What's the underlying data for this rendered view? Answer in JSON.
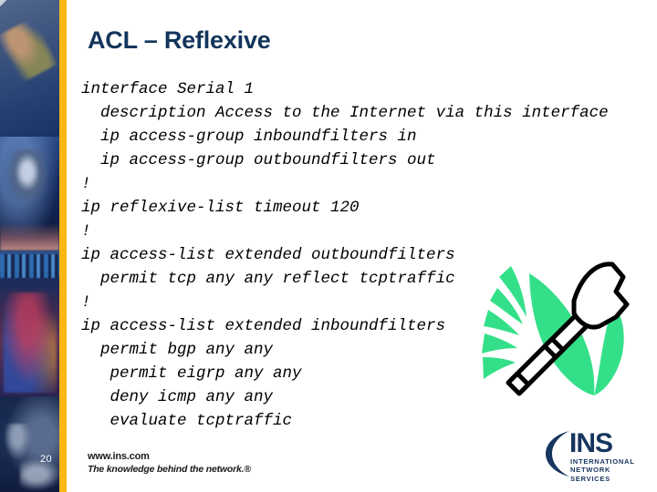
{
  "slide": {
    "title": "ACL – Reflexive",
    "number": "20",
    "background_color": "#ffffff",
    "title_color": "#13355c",
    "accent_stripe_color": "#fcb713"
  },
  "code": {
    "language": "cisco-ios-config",
    "lines": [
      "interface Serial 1",
      "  description Access to the Internet via this interface",
      "  ip access-group inboundfilters in",
      "  ip access-group outboundfilters out",
      "!",
      "ip reflexive-list timeout 120",
      "!",
      "ip access-list extended outboundfilters",
      "  permit tcp any any reflect tcptraffic",
      "!",
      "ip access-list extended inboundfilters",
      "  permit bgp any any",
      "   permit eigrp any any",
      "   deny icmp any any",
      "   evaluate tcptraffic"
    ]
  },
  "clipart": {
    "name": "axe-with-green-burst",
    "burst_color": "#33e089",
    "outline_color": "#000000",
    "fill_color": "#ffffff"
  },
  "footer": {
    "url": "www.ins.com",
    "tagline": "The knowledge behind the network.®"
  },
  "logo": {
    "wordmark": "INS",
    "line1": "INTERNATIONAL",
    "line2": "NETWORK SERVICES",
    "color": "#16355f"
  }
}
